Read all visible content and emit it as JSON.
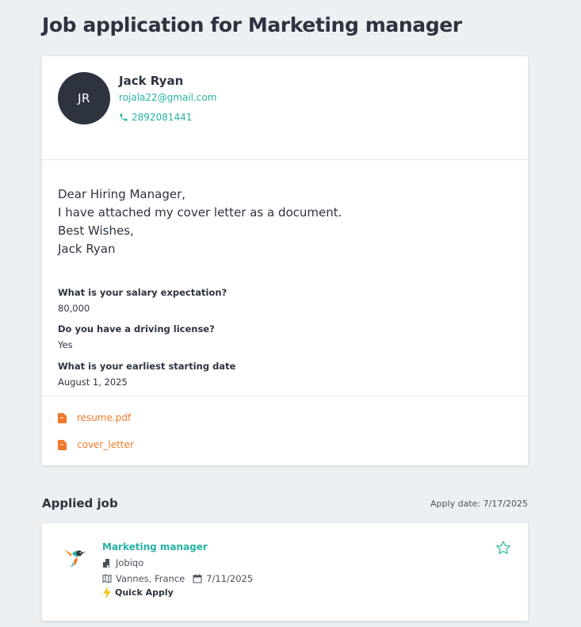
{
  "header": {
    "title": "Job application for Marketing manager"
  },
  "candidate": {
    "initials": "JR",
    "name": "Jack Ryan",
    "email": "rojala22@gmail.com",
    "phone": "2892081441"
  },
  "cover_letter": {
    "lines": [
      "Dear Hiring Manager,",
      "I have attached my cover letter as a document.",
      "Best Wishes,",
      "Jack Ryan"
    ]
  },
  "questions": [
    {
      "question": "What is your salary expectation?",
      "answer": "80,000"
    },
    {
      "question": "Do you have a driving license?",
      "answer": "Yes"
    },
    {
      "question": "What is your earliest starting date",
      "answer": "August 1, 2025"
    }
  ],
  "attachments": [
    {
      "name": "resume.pdf",
      "icon": "document-icon"
    },
    {
      "name": "cover_letter",
      "icon": "document-icon"
    }
  ],
  "applied_job": {
    "section_title": "Applied job",
    "apply_date": "Apply date: 7/17/2025",
    "title": "Marketing manager",
    "company": "Jobiqo",
    "location": "Vannes, France",
    "posted_date": "7/11/2025",
    "quick_apply": "Quick Apply",
    "logo": "hummingbird-logo"
  },
  "colors": {
    "accent": "#26b3a6",
    "file": "#f07a2c",
    "avatar": "#2e3340",
    "bolt": "#f5c518"
  }
}
